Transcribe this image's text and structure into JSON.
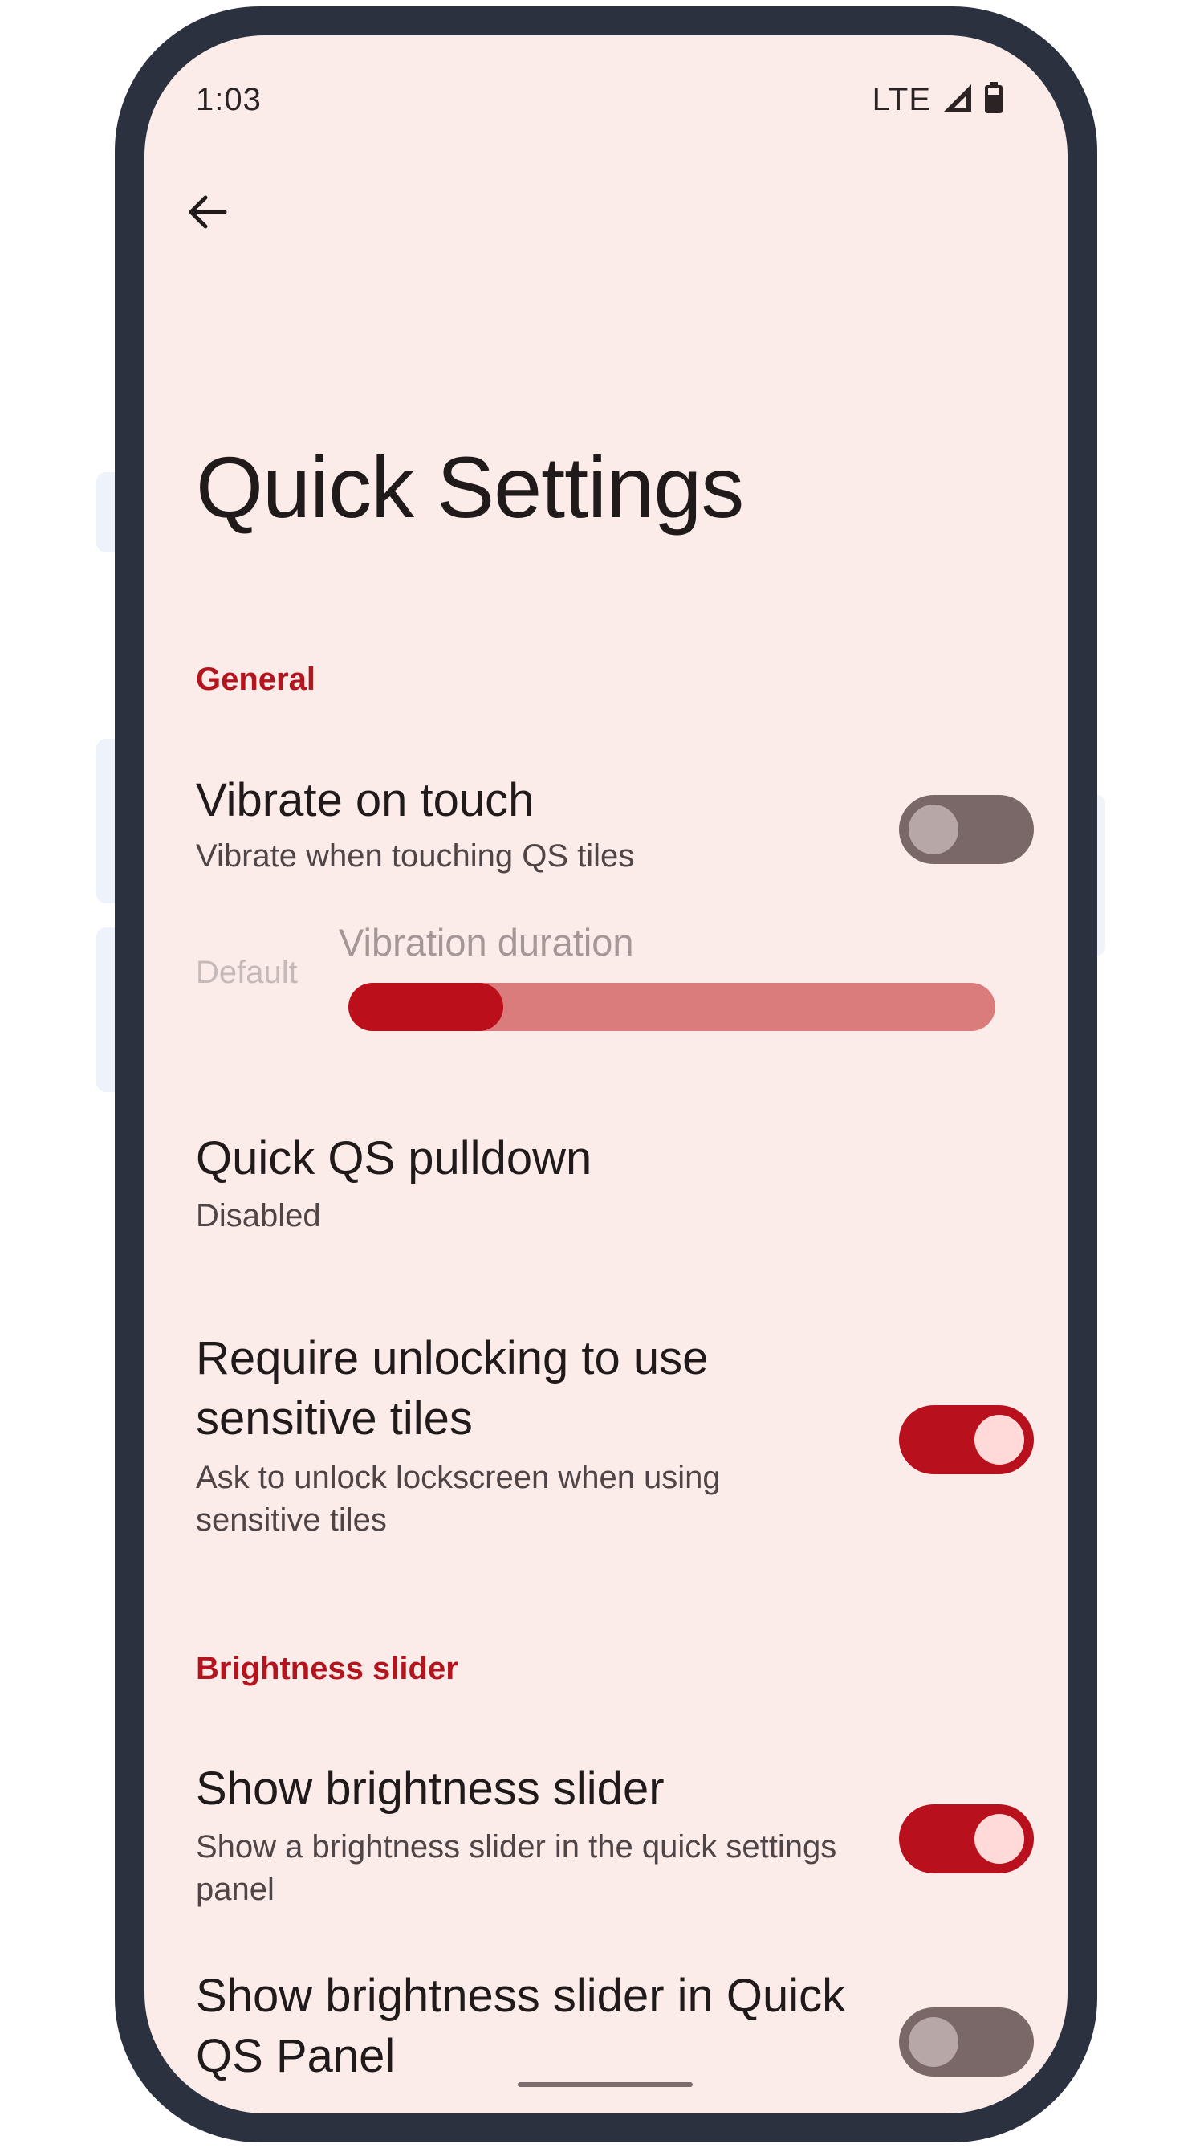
{
  "status_bar": {
    "time": "1:03",
    "network": "LTE",
    "icons": [
      "signal-icon",
      "battery-icon"
    ]
  },
  "nav": {
    "back_icon": "arrow-back-icon"
  },
  "page": {
    "title": "Quick Settings"
  },
  "sections": {
    "general": "General",
    "brightness": "Brightness slider"
  },
  "items": {
    "vibrate": {
      "title": "Vibrate on touch",
      "summary": "Vibrate when touching QS tiles",
      "enabled": false
    },
    "vibration_duration": {
      "title": "Vibration duration",
      "value_text": "Default",
      "fraction": 0.24,
      "enabled": false
    },
    "quick_pulldown": {
      "title": "Quick QS pulldown",
      "summary": "Disabled"
    },
    "require_unlock": {
      "title": "Require unlocking to use sensitive tiles",
      "summary": "Ask to unlock lockscreen when using sensitive tiles",
      "enabled": true
    },
    "show_brightness": {
      "title": "Show brightness slider",
      "summary": "Show a brightness slider in the quick settings panel",
      "enabled": true
    },
    "show_brightness_qqs": {
      "title": "Show brightness slider in Quick QS Panel",
      "enabled": false
    }
  },
  "colors": {
    "background": "#fbecea",
    "accent": "#b8111d",
    "frame": "#2c3140"
  }
}
